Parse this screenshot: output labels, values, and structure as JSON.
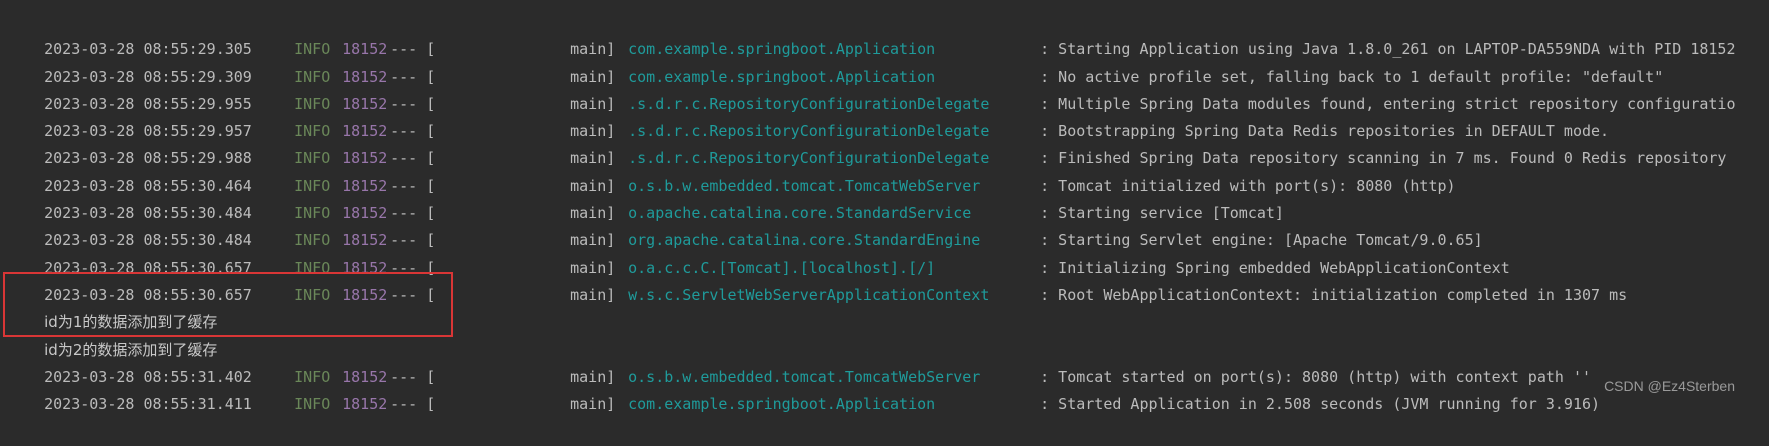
{
  "console": {
    "lines": [
      {
        "ts": "2023-03-28 08:55:29.305",
        "level": "INFO",
        "pid": "18152",
        "sep": "--- [",
        "thread": "main]",
        "logger": "com.example.springboot.Application",
        "message": ": Starting Application using Java 1.8.0_261 on LAPTOP-DA559NDA with PID 18152"
      },
      {
        "ts": "2023-03-28 08:55:29.309",
        "level": "INFO",
        "pid": "18152",
        "sep": "--- [",
        "thread": "main]",
        "logger": "com.example.springboot.Application",
        "message": ": No active profile set, falling back to 1 default profile: \"default\""
      },
      {
        "ts": "2023-03-28 08:55:29.955",
        "level": "INFO",
        "pid": "18152",
        "sep": "--- [",
        "thread": "main]",
        "logger": ".s.d.r.c.RepositoryConfigurationDelegate",
        "message": ": Multiple Spring Data modules found, entering strict repository configuratio"
      },
      {
        "ts": "2023-03-28 08:55:29.957",
        "level": "INFO",
        "pid": "18152",
        "sep": "--- [",
        "thread": "main]",
        "logger": ".s.d.r.c.RepositoryConfigurationDelegate",
        "message": ": Bootstrapping Spring Data Redis repositories in DEFAULT mode."
      },
      {
        "ts": "2023-03-28 08:55:29.988",
        "level": "INFO",
        "pid": "18152",
        "sep": "--- [",
        "thread": "main]",
        "logger": ".s.d.r.c.RepositoryConfigurationDelegate",
        "message": ": Finished Spring Data repository scanning in 7 ms. Found 0 Redis repository"
      },
      {
        "ts": "2023-03-28 08:55:30.464",
        "level": "INFO",
        "pid": "18152",
        "sep": "--- [",
        "thread": "main]",
        "logger": "o.s.b.w.embedded.tomcat.TomcatWebServer",
        "message": ": Tomcat initialized with port(s): 8080 (http)"
      },
      {
        "ts": "2023-03-28 08:55:30.484",
        "level": "INFO",
        "pid": "18152",
        "sep": "--- [",
        "thread": "main]",
        "logger": "o.apache.catalina.core.StandardService",
        "message": ": Starting service [Tomcat]"
      },
      {
        "ts": "2023-03-28 08:55:30.484",
        "level": "INFO",
        "pid": "18152",
        "sep": "--- [",
        "thread": "main]",
        "logger": "org.apache.catalina.core.StandardEngine",
        "message": ": Starting Servlet engine: [Apache Tomcat/9.0.65]"
      },
      {
        "ts": "2023-03-28 08:55:30.657",
        "level": "INFO",
        "pid": "18152",
        "sep": "--- [",
        "thread": "main]",
        "logger": "o.a.c.c.C.[Tomcat].[localhost].[/]",
        "message": ": Initializing Spring embedded WebApplicationContext"
      },
      {
        "ts": "2023-03-28 08:55:30.657",
        "level": "INFO",
        "pid": "18152",
        "sep": "--- [",
        "thread": "main]",
        "logger": "w.s.c.ServletWebServerApplicationContext",
        "message": ": Root WebApplicationContext: initialization completed in 1307 ms"
      },
      {
        "plain": "id为1的数据添加到了缓存"
      },
      {
        "plain": "id为2的数据添加到了缓存"
      },
      {
        "ts": "2023-03-28 08:55:31.402",
        "level": "INFO",
        "pid": "18152",
        "sep": "--- [",
        "thread": "main]",
        "logger": "o.s.b.w.embedded.tomcat.TomcatWebServer",
        "message": ": Tomcat started on port(s): 8080 (http) with context path ''"
      },
      {
        "ts": "2023-03-28 08:55:31.411",
        "level": "INFO",
        "pid": "18152",
        "sep": "--- [",
        "thread": "main]",
        "logger": "com.example.springboot.Application",
        "message": ": Started Application in 2.508 seconds (JVM running for 3.916)"
      }
    ]
  },
  "watermark": "CSDN @Ez4Sterben",
  "colors": {
    "background": "#2b2b2b",
    "text": "#bbbbbb",
    "level_info": "#6a8759",
    "pid": "#9876aa",
    "logger": "#1f9b9b",
    "highlight_border": "#d93636"
  }
}
